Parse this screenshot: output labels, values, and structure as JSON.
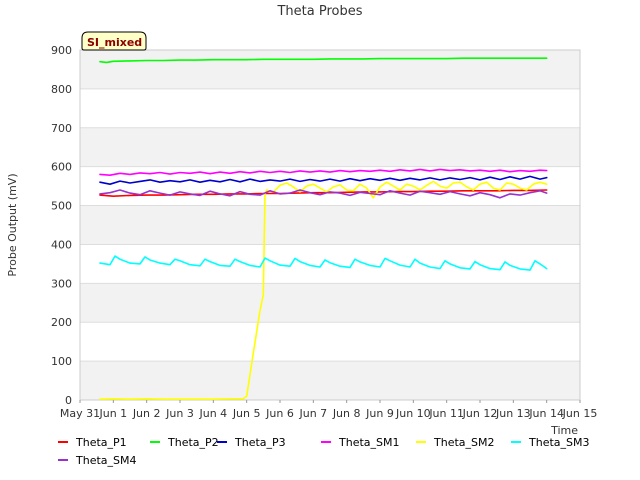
{
  "chart_data": {
    "type": "line",
    "title": "Theta Probes",
    "xlabel": "Time",
    "ylabel": "Probe Output (mV)",
    "badge": "SI_mixed",
    "x_tick_labels": [
      "May 31",
      "Jun 1",
      "Jun 2",
      "Jun 3",
      "Jun 4",
      "Jun 5",
      "Jun 6",
      "Jun 7",
      "Jun 8",
      "Jun 9",
      "Jun 10",
      "Jun 11",
      "Jun 12",
      "Jun 13",
      "Jun 14",
      "Jun 15"
    ],
    "xlim": [
      0,
      15
    ],
    "ylim": [
      0,
      900
    ],
    "y_ticks": [
      0,
      100,
      200,
      300,
      400,
      500,
      600,
      700,
      800,
      900
    ],
    "grid": true,
    "legend_position": "bottom",
    "series": [
      {
        "name": "Theta_P1",
        "color": "#ff0000",
        "x": [
          0.6,
          1.0,
          1.5,
          2.0,
          2.5,
          3.0,
          3.5,
          4.0,
          4.5,
          5.0,
          5.5,
          6.0,
          6.5,
          7.0,
          7.5,
          8.0,
          8.5,
          9.0,
          9.5,
          10.0,
          10.5,
          11.0,
          11.5,
          12.0,
          12.5,
          13.0,
          13.5,
          14.0
        ],
        "values": [
          527,
          524,
          526,
          527,
          527,
          528,
          529,
          529,
          530,
          530,
          531,
          531,
          532,
          533,
          533,
          534,
          535,
          535,
          536,
          536,
          537,
          537,
          538,
          538,
          538,
          539,
          539,
          540
        ]
      },
      {
        "name": "Theta_P2",
        "color": "#00ff00",
        "x": [
          0.6,
          0.8,
          1.0,
          1.5,
          2.0,
          2.5,
          3.0,
          3.5,
          4.0,
          4.5,
          5.0,
          5.5,
          6.0,
          6.5,
          7.0,
          7.5,
          8.0,
          8.5,
          9.0,
          9.5,
          10.0,
          10.5,
          11.0,
          11.5,
          12.0,
          12.5,
          13.0,
          13.5,
          14.0
        ],
        "values": [
          870,
          868,
          871,
          872,
          873,
          873,
          874,
          874,
          875,
          875,
          875,
          876,
          876,
          876,
          876,
          877,
          877,
          877,
          878,
          878,
          878,
          878,
          878,
          879,
          879,
          879,
          879,
          879,
          879
        ]
      },
      {
        "name": "Theta_P3",
        "color": "#0000cd",
        "x": [
          0.6,
          0.9,
          1.2,
          1.5,
          1.8,
          2.1,
          2.4,
          2.7,
          3.0,
          3.3,
          3.6,
          3.9,
          4.2,
          4.5,
          4.8,
          5.1,
          5.4,
          5.7,
          6.0,
          6.3,
          6.6,
          6.9,
          7.2,
          7.5,
          7.8,
          8.1,
          8.4,
          8.7,
          9.0,
          9.3,
          9.6,
          9.9,
          10.2,
          10.5,
          10.8,
          11.1,
          11.4,
          11.7,
          12.0,
          12.3,
          12.6,
          12.9,
          13.2,
          13.5,
          13.8,
          14.0
        ],
        "values": [
          560,
          555,
          563,
          558,
          562,
          566,
          560,
          564,
          561,
          566,
          560,
          565,
          561,
          567,
          561,
          568,
          562,
          566,
          563,
          568,
          562,
          567,
          563,
          568,
          563,
          569,
          564,
          569,
          565,
          570,
          565,
          570,
          566,
          571,
          566,
          571,
          567,
          572,
          566,
          573,
          567,
          574,
          568,
          575,
          568,
          572
        ]
      },
      {
        "name": "Theta_SM1",
        "color": "#ff00ff",
        "x": [
          0.6,
          0.9,
          1.2,
          1.5,
          1.8,
          2.1,
          2.4,
          2.7,
          3.0,
          3.3,
          3.6,
          3.9,
          4.2,
          4.5,
          4.8,
          5.1,
          5.4,
          5.7,
          6.0,
          6.3,
          6.6,
          6.9,
          7.2,
          7.5,
          7.8,
          8.1,
          8.4,
          8.7,
          9.0,
          9.3,
          9.6,
          9.9,
          10.2,
          10.5,
          10.8,
          11.1,
          11.4,
          11.7,
          12.0,
          12.3,
          12.6,
          12.9,
          13.2,
          13.5,
          13.8,
          14.0
        ],
        "values": [
          580,
          578,
          583,
          580,
          584,
          582,
          585,
          581,
          585,
          583,
          586,
          582,
          586,
          583,
          587,
          584,
          588,
          585,
          588,
          585,
          589,
          586,
          589,
          586,
          590,
          587,
          590,
          588,
          591,
          588,
          592,
          589,
          593,
          589,
          593,
          590,
          592,
          589,
          591,
          588,
          591,
          587,
          590,
          588,
          591,
          590
        ]
      },
      {
        "name": "Theta_SM2",
        "color": "#ffff00",
        "x": [
          0.6,
          1.0,
          1.5,
          2.0,
          2.5,
          3.0,
          3.5,
          4.0,
          4.5,
          4.9,
          5.0,
          5.2,
          5.4,
          5.5,
          5.55,
          5.6,
          5.8,
          6.0,
          6.2,
          6.4,
          6.6,
          6.8,
          7.0,
          7.2,
          7.4,
          7.6,
          7.8,
          8.0,
          8.2,
          8.4,
          8.6,
          8.8,
          9.0,
          9.2,
          9.4,
          9.6,
          9.8,
          10.0,
          10.2,
          10.4,
          10.6,
          10.8,
          11.0,
          11.2,
          11.4,
          11.6,
          11.8,
          12.0,
          12.2,
          12.4,
          12.6,
          12.8,
          13.0,
          13.2,
          13.4,
          13.6,
          13.8,
          14.0
        ],
        "values": [
          2,
          3,
          2,
          3,
          2,
          2,
          2,
          2,
          3,
          3,
          10,
          120,
          230,
          270,
          530,
          540,
          535,
          552,
          558,
          548,
          535,
          550,
          555,
          545,
          535,
          548,
          553,
          540,
          538,
          555,
          545,
          520,
          548,
          560,
          550,
          540,
          555,
          550,
          540,
          552,
          562,
          550,
          545,
          558,
          560,
          548,
          540,
          555,
          560,
          545,
          540,
          558,
          555,
          545,
          540,
          555,
          560,
          555
        ]
      },
      {
        "name": "Theta_SM3",
        "color": "#00ffff",
        "x": [
          0.6,
          0.9,
          1.05,
          1.2,
          1.5,
          1.8,
          1.95,
          2.1,
          2.4,
          2.7,
          2.85,
          3.0,
          3.3,
          3.6,
          3.75,
          3.9,
          4.2,
          4.5,
          4.65,
          4.8,
          5.1,
          5.4,
          5.55,
          5.7,
          6.0,
          6.3,
          6.45,
          6.6,
          6.9,
          7.2,
          7.35,
          7.5,
          7.8,
          8.1,
          8.25,
          8.4,
          8.7,
          9.0,
          9.15,
          9.3,
          9.6,
          9.9,
          10.05,
          10.2,
          10.5,
          10.8,
          10.95,
          11.1,
          11.4,
          11.7,
          11.85,
          12.0,
          12.3,
          12.6,
          12.75,
          12.9,
          13.2,
          13.5,
          13.65,
          13.8,
          14.0
        ],
        "values": [
          352,
          348,
          370,
          362,
          352,
          350,
          368,
          360,
          352,
          348,
          362,
          358,
          348,
          345,
          362,
          356,
          346,
          344,
          362,
          356,
          346,
          342,
          365,
          358,
          347,
          344,
          364,
          356,
          346,
          342,
          360,
          353,
          344,
          341,
          362,
          355,
          346,
          342,
          364,
          358,
          347,
          342,
          362,
          352,
          342,
          338,
          358,
          350,
          340,
          337,
          356,
          348,
          338,
          335,
          355,
          346,
          337,
          334,
          358,
          350,
          338
        ]
      },
      {
        "name": "Theta_SM4",
        "color": "#9932cc",
        "x": [
          0.6,
          0.9,
          1.2,
          1.5,
          1.8,
          2.1,
          2.4,
          2.7,
          3.0,
          3.3,
          3.6,
          3.9,
          4.2,
          4.5,
          4.8,
          5.1,
          5.4,
          5.7,
          6.0,
          6.3,
          6.6,
          6.9,
          7.2,
          7.5,
          7.8,
          8.1,
          8.4,
          8.7,
          9.0,
          9.3,
          9.6,
          9.9,
          10.2,
          10.5,
          10.8,
          11.1,
          11.4,
          11.7,
          12.0,
          12.3,
          12.6,
          12.9,
          13.2,
          13.5,
          13.8,
          14.0
        ],
        "values": [
          530,
          533,
          540,
          532,
          528,
          538,
          532,
          527,
          535,
          530,
          526,
          537,
          530,
          525,
          536,
          529,
          527,
          538,
          530,
          532,
          540,
          533,
          528,
          535,
          532,
          526,
          534,
          531,
          528,
          538,
          532,
          527,
          537,
          533,
          529,
          536,
          530,
          525,
          533,
          528,
          520,
          530,
          527,
          533,
          538,
          532
        ]
      }
    ]
  }
}
